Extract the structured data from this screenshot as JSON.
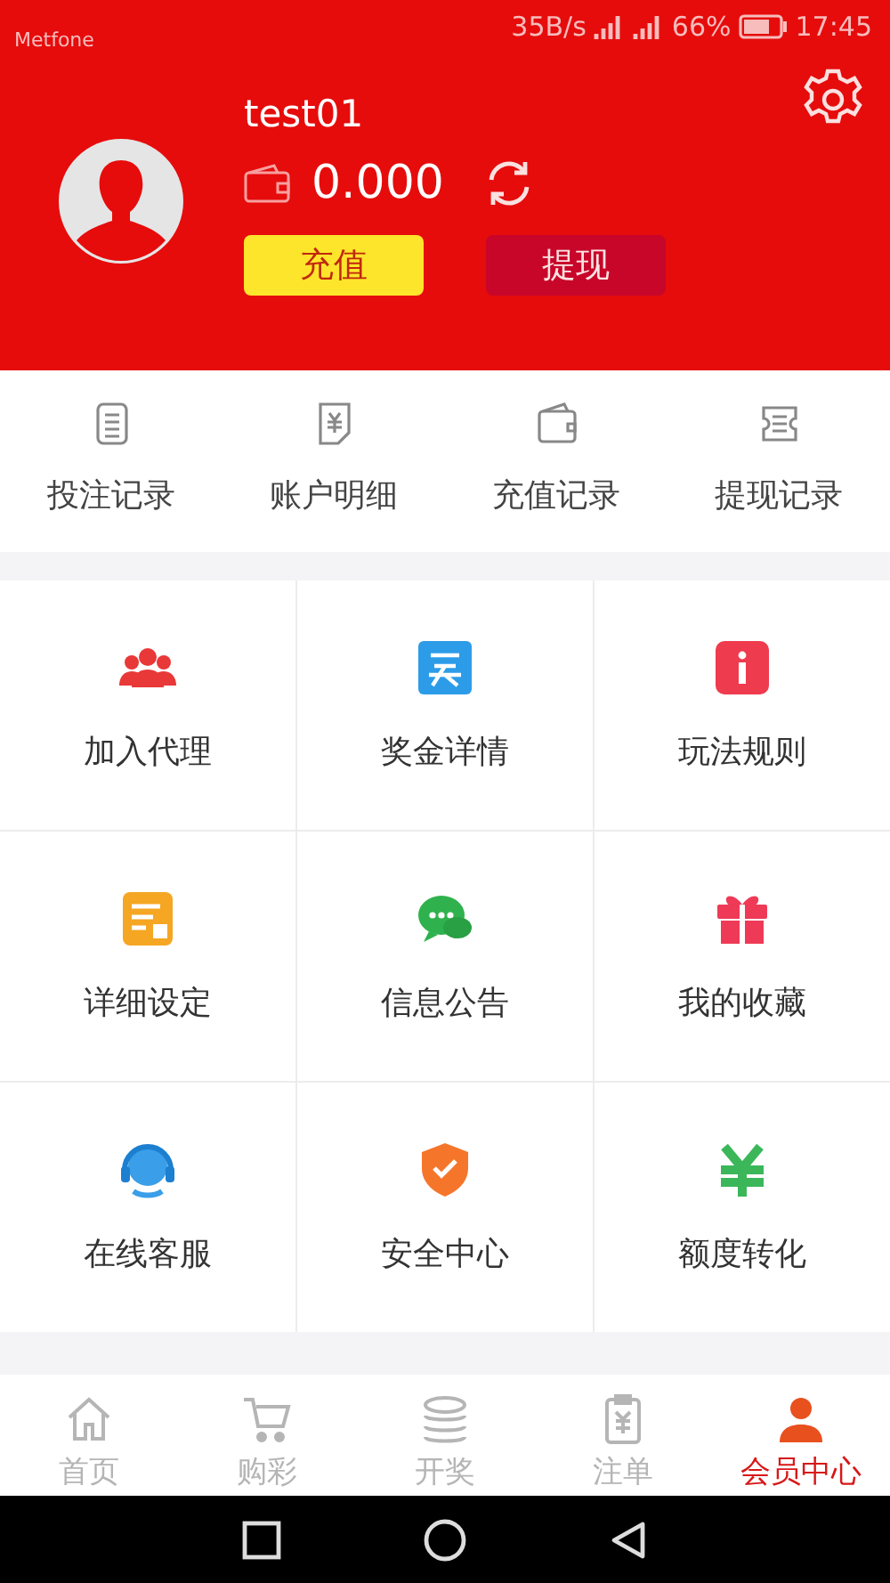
{
  "status_bar": {
    "carrier": "Metfone",
    "speed": "35B/s",
    "battery": "66%",
    "time": "17:45"
  },
  "profile": {
    "username": "test01",
    "balance": "0.000",
    "buttons": [
      {
        "label": "充值",
        "kind": "primary"
      },
      {
        "label": "提现",
        "kind": "secondary"
      }
    ]
  },
  "records": [
    {
      "label": "投注记录",
      "kind": "list"
    },
    {
      "label": "账户明细",
      "kind": "yuan"
    },
    {
      "label": "充值记录",
      "kind": "wallet"
    },
    {
      "label": "提现记录",
      "kind": "ticket"
    }
  ],
  "menu": [
    {
      "label": "加入代理",
      "kind": "agent"
    },
    {
      "label": "奖金详情",
      "kind": "prize"
    },
    {
      "label": "玩法规则",
      "kind": "rules"
    },
    {
      "label": "详细设定",
      "kind": "settings"
    },
    {
      "label": "信息公告",
      "kind": "notice"
    },
    {
      "label": "我的收藏",
      "kind": "favorite"
    },
    {
      "label": "在线客服",
      "kind": "service"
    },
    {
      "label": "安全中心",
      "kind": "security"
    },
    {
      "label": "额度转化",
      "kind": "convert"
    }
  ],
  "tabs": [
    {
      "label": "首页",
      "kind": "home",
      "selected": false
    },
    {
      "label": "购彩",
      "kind": "cart",
      "selected": false
    },
    {
      "label": "开奖",
      "kind": "coins",
      "selected": false
    },
    {
      "label": "注单",
      "kind": "order",
      "selected": false
    },
    {
      "label": "会员中心",
      "kind": "member",
      "selected": true
    }
  ]
}
